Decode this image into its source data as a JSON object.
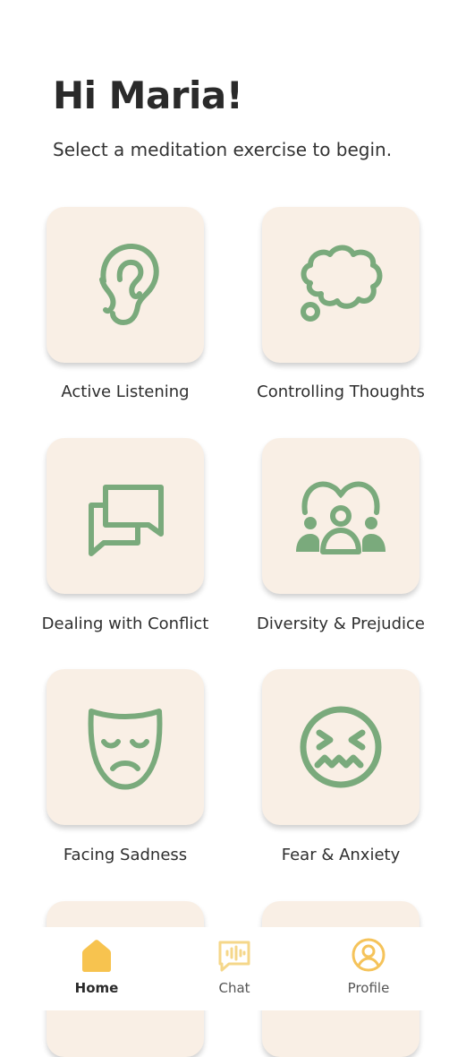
{
  "greeting": "Hi Maria!",
  "subtitle": "Select a meditation exercise to begin.",
  "exercises": [
    {
      "label": "Active Listening",
      "icon": "ear-icon"
    },
    {
      "label": "Controlling Thoughts",
      "icon": "thought-bubble-icon"
    },
    {
      "label": "Dealing with Conflict",
      "icon": "chat-bubbles-icon"
    },
    {
      "label": "Diversity & Prejudice",
      "icon": "group-people-icon"
    },
    {
      "label": "Facing Sadness",
      "icon": "sad-mask-icon"
    },
    {
      "label": "Fear & Anxiety",
      "icon": "anxious-face-icon"
    }
  ],
  "nav": [
    {
      "label": "Home",
      "icon": "home-icon",
      "active": true
    },
    {
      "label": "Chat",
      "icon": "chat-audio-icon",
      "active": false
    },
    {
      "label": "Profile",
      "icon": "profile-icon",
      "active": false
    }
  ],
  "colors": {
    "icon_green": "#7aaa7c",
    "card_bg": "#f9efe5",
    "nav_accent": "#f7c34f",
    "nav_accent_light": "#f5d78a"
  }
}
